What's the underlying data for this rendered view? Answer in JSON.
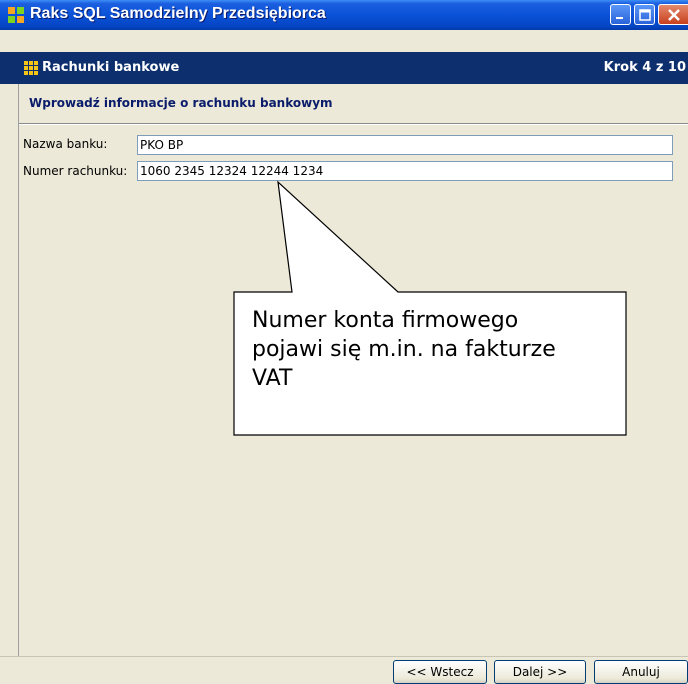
{
  "window": {
    "title": "Raks SQL Samodzielny Przedsiębiorca",
    "app_icon": "raks-app-icon"
  },
  "wizard": {
    "step_title": "Rachunki bankowe",
    "step_counter": "Krok 4 z 10",
    "step_icon": "grid-icon",
    "section_header": "Wprowadź informacje o rachunku bankowym"
  },
  "form": {
    "bank_name": {
      "label": "Nazwa banku:",
      "value": "PKO BP"
    },
    "account_number": {
      "label": "Numer rachunku:",
      "value": "1060 2345 12324 12244 1234"
    }
  },
  "buttons": {
    "back": "<< Wstecz",
    "next": "Dalej >>",
    "cancel": "Anuluj"
  },
  "callout": {
    "line1": "Numer konta firmowego",
    "line2": "pojawi się m.in. na fakturze",
    "line3": "VAT"
  },
  "colors": {
    "titlebar": "#0a52d8",
    "stepbar": "#0e2f6e",
    "section_header_text": "#0a1c6a",
    "face": "#ece9d8"
  }
}
